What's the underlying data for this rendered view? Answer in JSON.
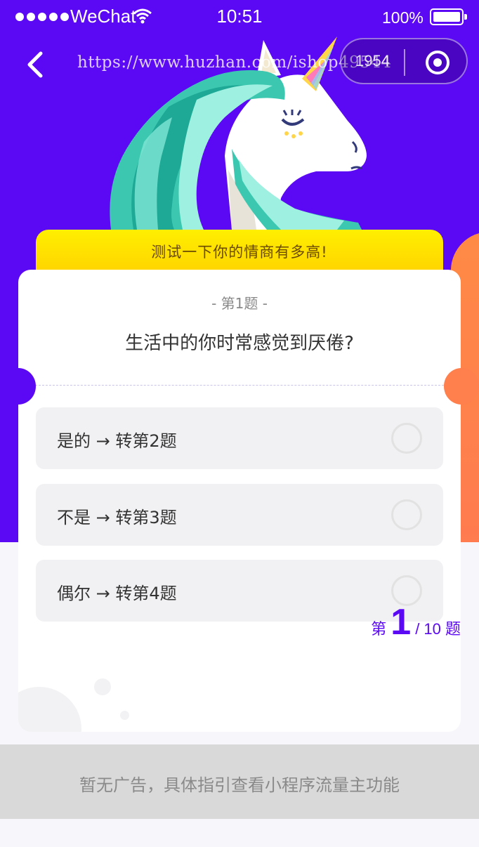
{
  "status_bar": {
    "carrier": "WeChat",
    "time": "10:51",
    "battery": "100%"
  },
  "nav": {
    "url": "https://www.huzhan.com/ishop49544",
    "capsule_count": "1954"
  },
  "quiz": {
    "title": "测试一下你的情商有多高!",
    "question_number": "- 第1题 -",
    "question_text": "生活中的你时常感觉到厌倦?",
    "options": [
      {
        "label": "是的 → 转第2题"
      },
      {
        "label": "不是 → 转第3题"
      },
      {
        "label": "偶尔 → 转第4题"
      }
    ],
    "progress": {
      "prefix": "第",
      "current": "1",
      "total": "/ 10 题"
    }
  },
  "ad": {
    "text": "暂无广告，具体指引查看小程序流量主功能"
  },
  "colors": {
    "primary": "#5b08f5",
    "accent": "#ff7f4d",
    "banner": "#ffe000"
  },
  "icons": [
    "back-arrow-icon",
    "wifi-icon",
    "battery-icon",
    "target-icon"
  ]
}
